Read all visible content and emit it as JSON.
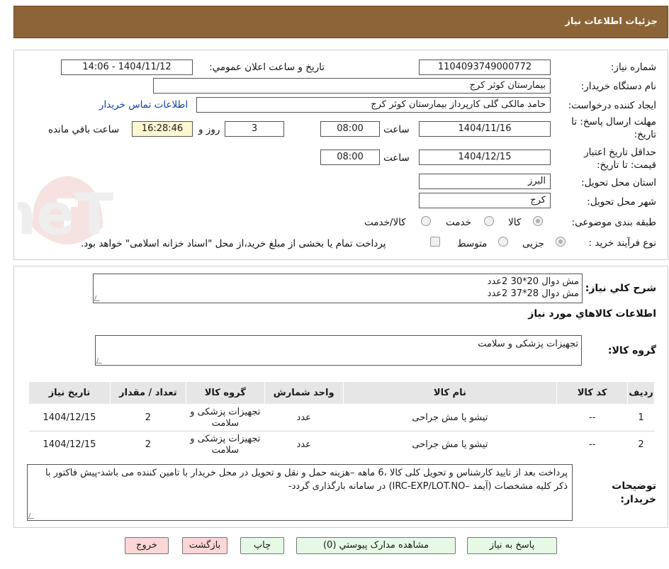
{
  "header": {
    "title": "جزئیات اطلاعات نیاز"
  },
  "watermark": {
    "text": "AriaTender.neT"
  },
  "form": {
    "need_number_label": "شماره نیاز:",
    "need_number": "1104093749000772",
    "announce_label": "تاریخ و ساعت اعلان عمومي:",
    "announce_value": "1404/11/12 - 14:06",
    "buyer_org_label": "نام دستگاه خریدار:",
    "buyer_org": "بیمارستان کوثر کرج",
    "requester_label": "ایجاد کننده درخواست:",
    "requester": "حامد مالکی گلی کارپرداز بیمارستان کوثر کرج",
    "contact_link": "اطلاعات تماس خریدار",
    "reply_deadline_label": "مهلت ارسال پاسخ: تا تاریخ:",
    "reply_date": "1404/11/16",
    "time_label": "ساعت",
    "reply_time": "08:00",
    "days_value": "3",
    "days_label": "روز و",
    "remaining_time": "16:28:46",
    "remaining_label": "ساعت باقي مانده",
    "validity_label": "حداقل تاریخ اعتبار قیمت: تا تاریخ:",
    "validity_date": "1404/12/15",
    "validity_time": "08:00",
    "province_label": "استان محل تحویل:",
    "province": "البرز",
    "city_label": "شهر محل تحویل:",
    "city": "کرج",
    "category_label": "طبقه بندی موضوعی:",
    "category_options": [
      "کالا",
      "خدمت",
      "کالا/خدمت"
    ],
    "process_label": "نوع فرآیند خرید :",
    "process_options": [
      "جزیی",
      "متوسط"
    ],
    "payment_note": "پرداخت تمام یا بخشی از مبلغ خرید،از محل \"اسناد خزانه اسلامی\" خواهد بود."
  },
  "summary": {
    "label": "شرح کلي نیاز:",
    "lines": [
      "مش دوال 20*30  2عدد",
      "مش دوال 28*37  2عدد"
    ]
  },
  "goods_info": {
    "heading": "اطلاعات کالاهاي مورد نیاز",
    "group_label": "گروه کالا:",
    "group_value": "تجهیزات پزشکی و سلامت"
  },
  "table": {
    "headers": [
      "ردیف",
      "کد کالا",
      "نام کالا",
      "واحد شمارش",
      "گروه کالا",
      "تعداد / مقدار",
      "تاریخ نیاز"
    ],
    "rows": [
      {
        "row": "1",
        "code": "--",
        "name": "تیشو یا مش جراحی",
        "unit": "عدد",
        "group": "تجهیزات پزشکی و سلامت",
        "qty": "2",
        "date": "1404/12/15"
      },
      {
        "row": "2",
        "code": "--",
        "name": "تیشو یا مش جراحی",
        "unit": "عدد",
        "group": "تجهیزات پزشکی و سلامت",
        "qty": "2",
        "date": "1404/12/15"
      }
    ]
  },
  "buyer_notes": {
    "label": "توضیحات خریدار:",
    "text": "پرداخت بعد از تایید کارشناس و تحویل کلی کالا ،6 ماهه –هزینه حمل و نقل و تحویل در محل خریدار با تامین کننده می باشد-پیش فاکتور با ذکر کلیه مشخصات (آیمد –IRC-EXP/LOT.NO) در سامانه بارگذاری گردد-"
  },
  "buttons": {
    "reply": "پاسخ به نیاز",
    "attachments": "مشاهده مدارک پیوستي (0)",
    "print": "چاپ",
    "back": "بازگشت",
    "exit": "خروج"
  },
  "colors": {
    "header_bg": "#8c6437",
    "button_green": "#e6f8e6",
    "button_pink": "#fbd6d6",
    "link": "#1540a8"
  }
}
